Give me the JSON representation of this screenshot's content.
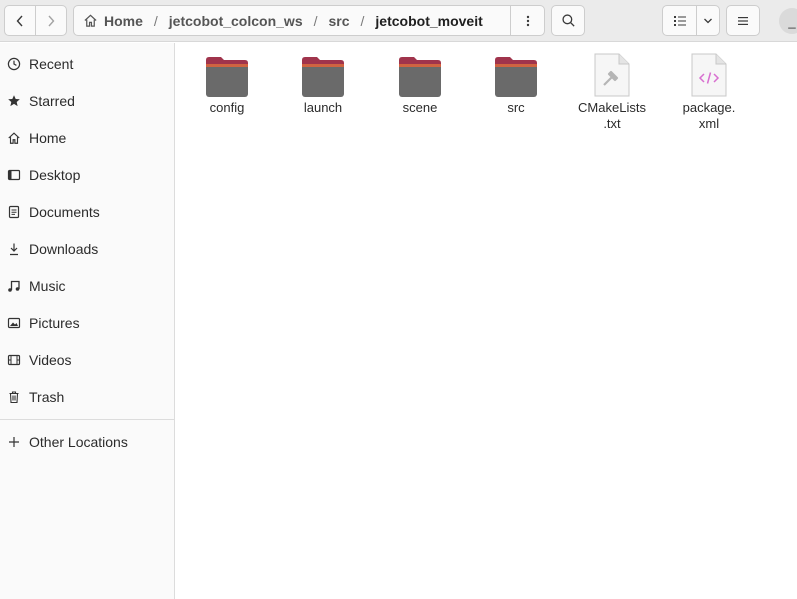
{
  "header": {
    "path": [
      {
        "label": "Home"
      },
      {
        "label": "jetcobot_colcon_ws"
      },
      {
        "label": "src"
      },
      {
        "label": "jetcobot_moveit"
      }
    ],
    "separator": "/",
    "minimize_glyph": "_"
  },
  "sidebar": {
    "items": [
      {
        "label": "Recent",
        "icon": "clock-icon"
      },
      {
        "label": "Starred",
        "icon": "star-icon"
      },
      {
        "label": "Home",
        "icon": "home-icon"
      },
      {
        "label": "Desktop",
        "icon": "desktop-icon"
      },
      {
        "label": "Documents",
        "icon": "document-icon"
      },
      {
        "label": "Downloads",
        "icon": "download-icon"
      },
      {
        "label": "Music",
        "icon": "music-icon"
      },
      {
        "label": "Pictures",
        "icon": "picture-icon"
      },
      {
        "label": "Videos",
        "icon": "video-icon"
      },
      {
        "label": "Trash",
        "icon": "trash-icon"
      }
    ],
    "other_locations": {
      "label": "Other Locations",
      "icon": "plus-icon"
    }
  },
  "files": [
    {
      "name": "config",
      "type": "folder"
    },
    {
      "name": "launch",
      "type": "folder"
    },
    {
      "name": "scene",
      "type": "folder"
    },
    {
      "name": "src",
      "type": "folder"
    },
    {
      "name": "CMakeLists\n.txt",
      "type": "cmake-file"
    },
    {
      "name": "package.\nxml",
      "type": "xml-file"
    }
  ],
  "colors": {
    "folder_tab": "#a0344c",
    "folder_body": "#6a6a6a",
    "folder_accent": "#e0633a",
    "xml_accent": "#d86fd0"
  }
}
